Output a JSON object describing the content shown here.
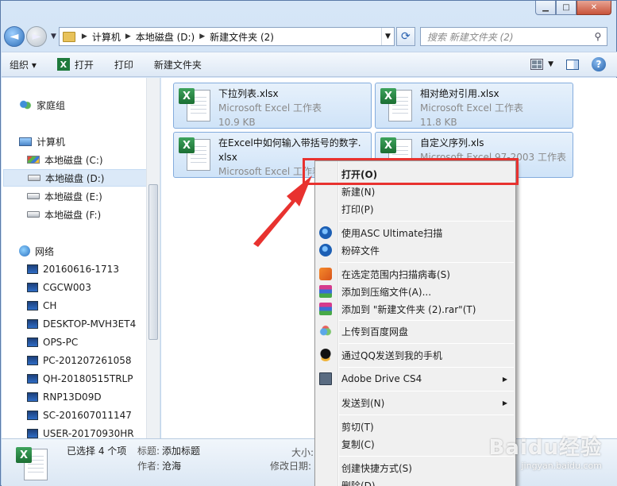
{
  "window": {
    "minimize_glyph": "▁",
    "maximize_glyph": "□",
    "close_glyph": "✕"
  },
  "address_bar": {
    "crumbs": [
      "计算机",
      "本地磁盘 (D:)",
      "新建文件夹 (2)"
    ],
    "search_placeholder": "搜索 新建文件夹 (2)"
  },
  "toolbar": {
    "organize": "组织 ▾",
    "open": "打开",
    "print": "打印",
    "new_folder": "新建文件夹"
  },
  "nav": {
    "homegroup": "家庭组",
    "computer": "计算机",
    "drives": [
      "本地磁盘 (C:)",
      "本地磁盘 (D:)",
      "本地磁盘 (E:)",
      "本地磁盘 (F:)"
    ],
    "network": "网络",
    "hosts": [
      "20160616-1713",
      "CGCW003",
      "CH",
      "DESKTOP-MVH3ET4",
      "OPS-PC",
      "PC-201207261058",
      "QH-20180515TRLP",
      "RNP13D09D",
      "SC-201607011147",
      "USER-20170930HR"
    ]
  },
  "files": [
    {
      "name": "下拉列表.xlsx",
      "type": "Microsoft Excel 工作表",
      "size": "10.9 KB"
    },
    {
      "name": "相对绝对引用.xlsx",
      "type": "Microsoft Excel 工作表",
      "size": "11.8 KB"
    },
    {
      "name_line1": "在Excel中如何输入带括号的数字.",
      "name_line2": "xlsx",
      "type": "Microsoft Excel 工作表"
    },
    {
      "name": "自定义序列.xls",
      "type": "Microsoft Excel 97-2003 工作表"
    }
  ],
  "details": {
    "selected": "已选择 4 个项",
    "title_label": "标题:",
    "title_value": "添加标题",
    "author_label": "作者:",
    "author_value": "沧海",
    "size_label": "大小:",
    "modified_label": "修改日期:"
  },
  "context_menu": {
    "open": "打开(O)",
    "new": "新建(N)",
    "print": "打印(P)",
    "asc_scan": "使用ASC Ultimate扫描",
    "shred": "粉碎文件",
    "virus_scan": "在选定范围内扫描病毒(S)",
    "add_archive": "添加到压缩文件(A)...",
    "add_to_rar": "添加到 \"新建文件夹 (2).rar\"(T)",
    "baidu_upload": "上传到百度网盘",
    "qq_send": "通过QQ发送到我的手机",
    "adobe_drive": "Adobe Drive CS4",
    "send_to": "发送到(N)",
    "cut": "剪切(T)",
    "copy": "复制(C)",
    "shortcut": "创建快捷方式(S)",
    "delete": "删除(D)"
  },
  "watermark": {
    "brand": "Baidu经验",
    "url": "jingyan.baidu.com"
  },
  "colors": {
    "annotation_red": "#e8322f",
    "selection_blue": "#cfe3f8"
  }
}
